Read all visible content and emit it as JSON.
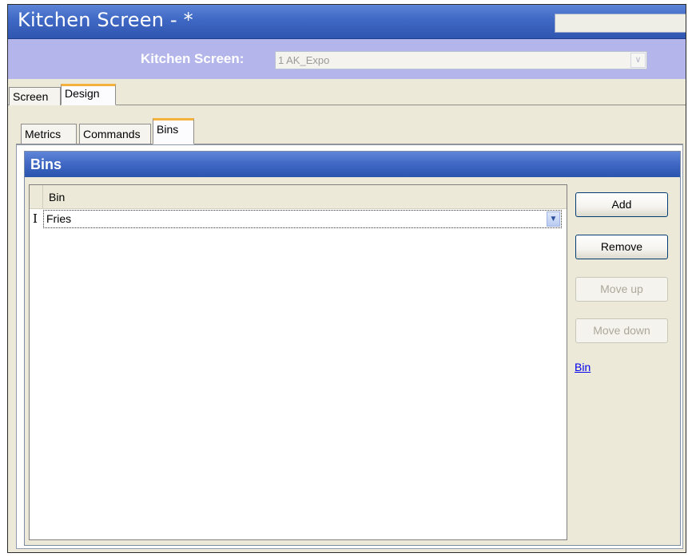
{
  "window": {
    "title": "Kitchen Screen - *"
  },
  "selector": {
    "label": "Kitchen Screen:",
    "value": "1 AK_Expo"
  },
  "main_tabs": [
    {
      "label": "Screen",
      "active": false
    },
    {
      "label": "Design",
      "active": true
    }
  ],
  "sub_tabs": [
    {
      "label": "Metrics",
      "active": false
    },
    {
      "label": "Commands",
      "active": false
    },
    {
      "label": "Bins",
      "active": true
    }
  ],
  "bins_group": {
    "title": "Bins",
    "grid": {
      "columns": [
        "Bin"
      ],
      "rows": [
        {
          "bin": "Fries"
        }
      ]
    },
    "buttons": {
      "add": "Add",
      "remove": "Remove",
      "move_up": "Move up",
      "move_down": "Move down"
    },
    "help_link": "Bin"
  },
  "colors": {
    "title_blue": "#3f68c4",
    "selector_lavender": "#b3b5eb",
    "active_tab_accent": "#f4b13c",
    "link": "#0000ee"
  },
  "icons": {
    "combo_dropdown": "chevron-down-icon",
    "row_cursor": "text-cursor-icon"
  }
}
